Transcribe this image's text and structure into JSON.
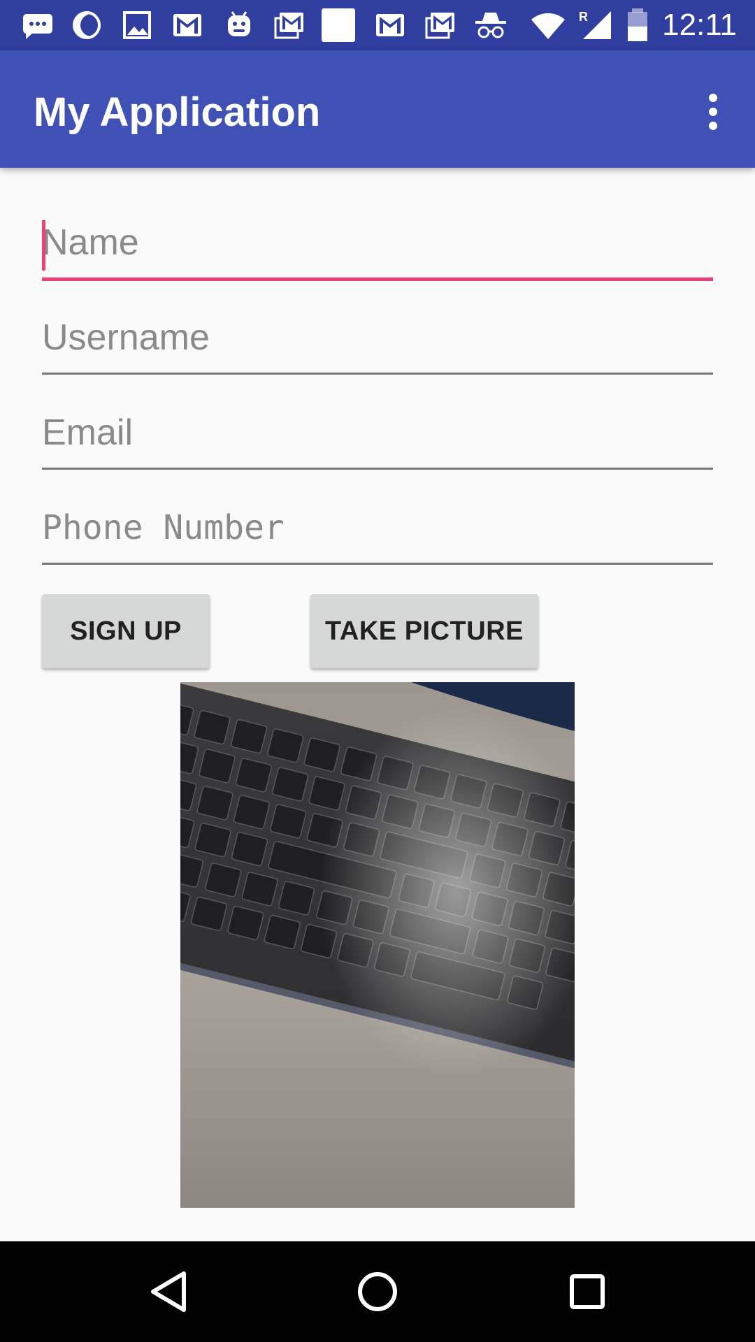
{
  "status_bar": {
    "time": "12:11",
    "notification_icons": [
      "chat-bubble-icon",
      "moon-icon",
      "image-icon",
      "gmail-icon",
      "android-icon",
      "gmail-stack-icon",
      "blank-square-icon",
      "gmail-icon",
      "gmail-stack-icon",
      "incognito-icon"
    ],
    "system_icons": [
      "wifi-icon",
      "signal-roaming-icon",
      "battery-icon"
    ],
    "roaming_indicator": "R"
  },
  "app_bar": {
    "title": "My Application",
    "overflow_icon": "more-vert-icon",
    "background": "#3f51b5",
    "status_background": "#303f9f"
  },
  "form": {
    "name": {
      "value": "",
      "placeholder": "Name"
    },
    "username": {
      "value": "",
      "placeholder": "Username"
    },
    "email": {
      "value": "",
      "placeholder": "Email"
    },
    "phone": {
      "value": "",
      "placeholder": "Phone Number"
    },
    "accent_color": "#ec407a"
  },
  "buttons": {
    "sign_up": "SIGN UP",
    "take_picture": "TAKE PICTURE"
  },
  "photo": {
    "subject": "keyboard-photo"
  },
  "nav_bar": {
    "back_icon": "back-triangle-icon",
    "home_icon": "home-circle-icon",
    "recents_icon": "recents-square-icon"
  }
}
